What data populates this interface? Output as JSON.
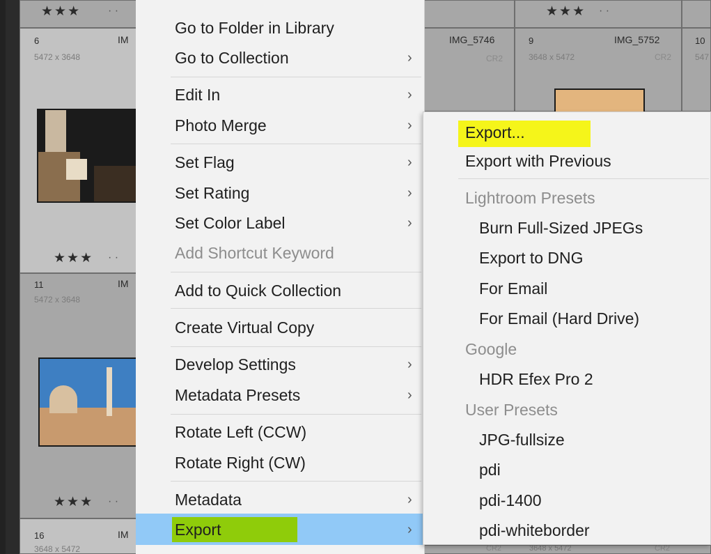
{
  "grid": {
    "cells": [
      {
        "num": "6",
        "name": "IM",
        "dims": "5472 x 3648"
      },
      {
        "num": "",
        "name": "IMG_5746",
        "dims": "",
        "type": "CR2"
      },
      {
        "num": "9",
        "name": "IMG_5752",
        "dims": "3648 x 5472",
        "type": "CR2"
      },
      {
        "num": "10",
        "name": "",
        "dims": "547"
      },
      {
        "num": "11",
        "name": "IM",
        "dims": "5472 x 3648"
      },
      {
        "num": "16",
        "name": "IM",
        "dims": "3648 x 5472"
      }
    ],
    "stars": "★★★",
    "dots": "·  ·",
    "bottom_texts": {
      "cr2a": "CR2",
      "dims": "3648 x 5472",
      "cr2b": "CR2"
    }
  },
  "context_menu": {
    "items": [
      {
        "label": "Go to Folder in Library",
        "submenu": false
      },
      {
        "label": "Go to Collection",
        "submenu": true
      },
      {
        "label": "Edit In",
        "submenu": true
      },
      {
        "label": "Photo Merge",
        "submenu": true
      },
      {
        "label": "Set Flag",
        "submenu": true
      },
      {
        "label": "Set Rating",
        "submenu": true
      },
      {
        "label": "Set Color Label",
        "submenu": true
      },
      {
        "label": "Add Shortcut Keyword",
        "submenu": false,
        "disabled": true
      },
      {
        "label": "Add to Quick Collection",
        "submenu": false
      },
      {
        "label": "Create Virtual Copy",
        "submenu": false
      },
      {
        "label": "Develop Settings",
        "submenu": true
      },
      {
        "label": "Metadata Presets",
        "submenu": true
      },
      {
        "label": "Rotate Left (CCW)",
        "submenu": false
      },
      {
        "label": "Rotate Right (CW)",
        "submenu": false
      },
      {
        "label": "Metadata",
        "submenu": true
      },
      {
        "label": "Export",
        "submenu": true,
        "selected": true
      }
    ],
    "arrow": "›"
  },
  "export_submenu": {
    "export": "Export...",
    "export_previous": "Export with Previous",
    "groups": [
      {
        "header": "Lightroom Presets",
        "items": [
          "Burn Full-Sized JPEGs",
          "Export to DNG",
          "For Email",
          "For Email (Hard Drive)"
        ]
      },
      {
        "header": "Google",
        "items": [
          "HDR Efex Pro 2"
        ]
      },
      {
        "header": "User Presets",
        "items": [
          "JPG-fullsize",
          "pdi",
          "pdi-1400",
          "pdi-whiteborder"
        ]
      }
    ]
  },
  "colors": {
    "menu_bg": "#f2f2f2",
    "selected_bg": "#91c9f7",
    "highlight_yellow": "#f5f51a",
    "highlight_green": "#8fcc0a"
  }
}
